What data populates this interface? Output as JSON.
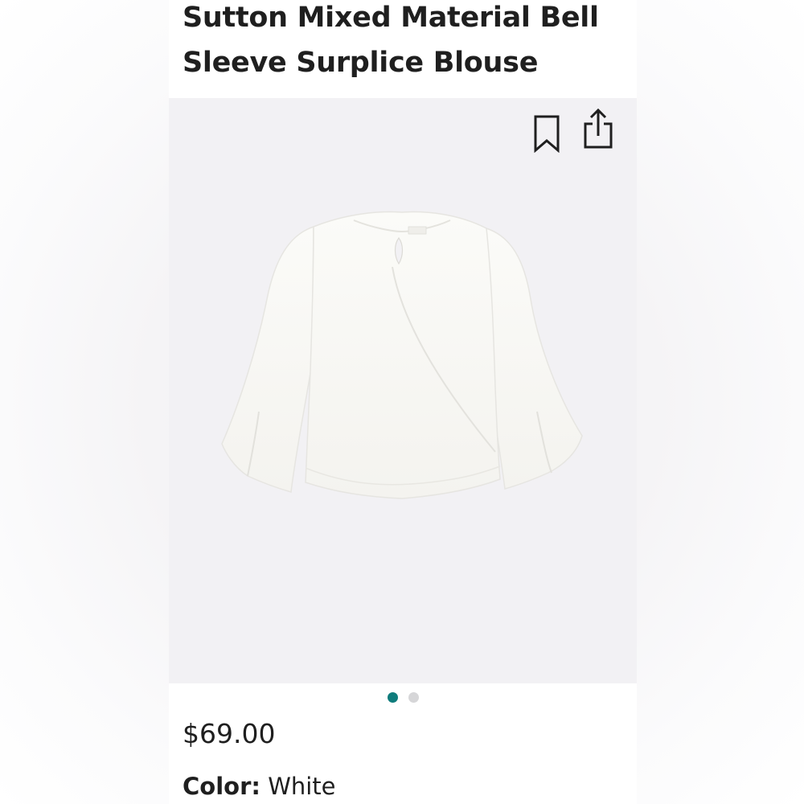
{
  "product": {
    "title": "Sutton Mixed Material Bell Sleeve Surplice Blouse",
    "price": "$69.00",
    "color_label": "Color:",
    "color_value": "White"
  },
  "gallery": {
    "active_index": 0,
    "total_images": 2
  },
  "icons": {
    "bookmark": "bookmark-icon",
    "share": "share-icon"
  },
  "colors": {
    "accent_dot": "#0f7c7c",
    "inactive_dot": "#d6d6d8",
    "image_background": "#f2f1f4",
    "text": "#1f1f1f"
  }
}
